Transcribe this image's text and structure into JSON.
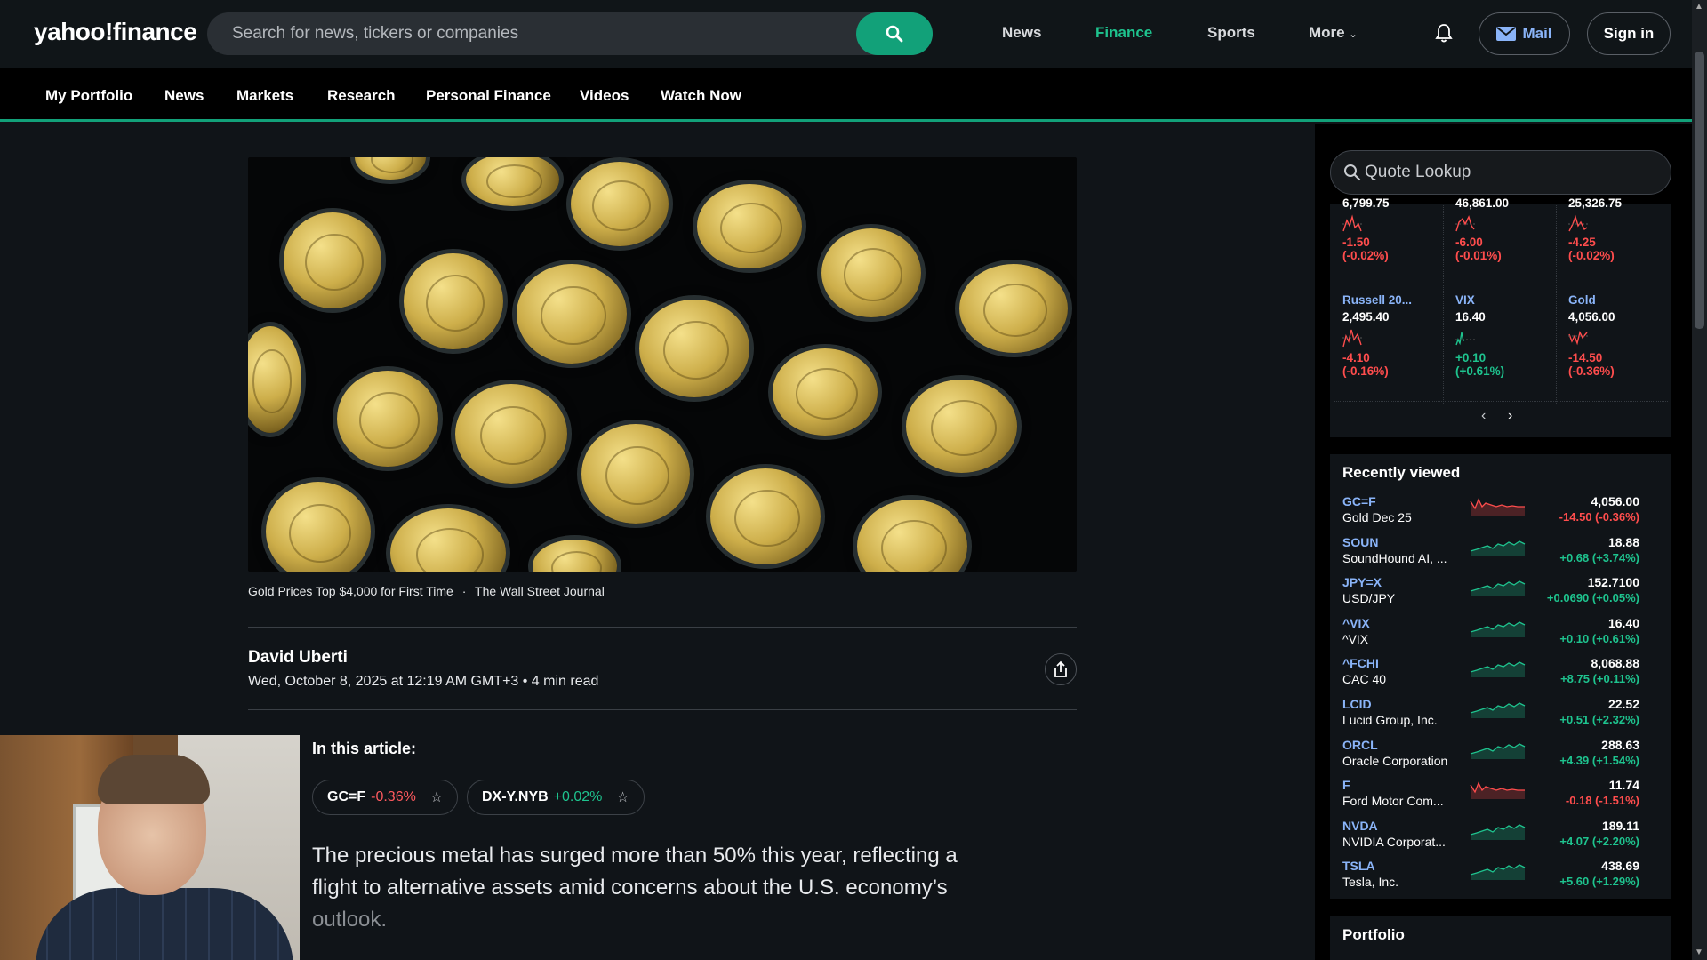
{
  "header": {
    "logo": "yahoo!finance",
    "search_placeholder": "Search for news, tickers or companies",
    "nav": [
      "News",
      "Finance",
      "Sports",
      "More"
    ],
    "active_nav": "Finance",
    "mail_label": "Mail",
    "signin_label": "Sign in"
  },
  "subnav": [
    "My Portfolio",
    "News",
    "Markets",
    "Research",
    "Personal Finance",
    "Videos",
    "Watch Now"
  ],
  "article": {
    "caption": "Gold Prices Top $4,000 for First Time",
    "caption_sep": "·",
    "source": "The Wall Street Journal",
    "author": "David Uberti",
    "dateline": "Wed, October 8, 2025 at 12:19 AM GMT+3 • 4 min read",
    "in_article_label": "In this article:",
    "tickers": [
      {
        "symbol": "GC=F",
        "change": "-0.36%",
        "direction": "down"
      },
      {
        "symbol": "DX-Y.NYB",
        "change": "+0.02%",
        "direction": "up"
      }
    ],
    "lede_main": "The precious metal has surged more than 50% this year, reflecting a flight to alternative assets amid concerns about the U.S. economy’s",
    "lede_faded": "outlook."
  },
  "right_rail": {
    "quote_placeholder": "Quote Lookup",
    "markets_top": [
      {
        "value": "6,799.75",
        "change": "-1.50",
        "pct": "(-0.02%)",
        "direction": "down"
      },
      {
        "value": "46,861.00",
        "change": "-6.00",
        "pct": "(-0.01%)",
        "direction": "down"
      },
      {
        "value": "25,326.75",
        "change": "-4.25",
        "pct": "(-0.02%)",
        "direction": "down"
      }
    ],
    "markets_bottom": [
      {
        "name": "Russell 20...",
        "value": "2,495.40",
        "change": "-4.10",
        "pct": "(-0.16%)",
        "direction": "down"
      },
      {
        "name": "VIX",
        "value": "16.40",
        "change": "+0.10",
        "pct": "(+0.61%)",
        "direction": "up"
      },
      {
        "name": "Gold",
        "value": "4,056.00",
        "change": "-14.50",
        "pct": "(-0.36%)",
        "direction": "down"
      }
    ],
    "recently_viewed_title": "Recently viewed",
    "recently_viewed": [
      {
        "symbol": "GC=F",
        "name": "Gold Dec 25",
        "price": "4,056.00",
        "change": "-14.50 (-0.36%)",
        "direction": "down"
      },
      {
        "symbol": "SOUN",
        "name": "SoundHound AI, ...",
        "price": "18.88",
        "change": "+0.68 (+3.74%)",
        "direction": "up"
      },
      {
        "symbol": "JPY=X",
        "name": "USD/JPY",
        "price": "152.7100",
        "change": "+0.0690 (+0.05%)",
        "direction": "up"
      },
      {
        "symbol": "^VIX",
        "name": "^VIX",
        "price": "16.40",
        "change": "+0.10 (+0.61%)",
        "direction": "up"
      },
      {
        "symbol": "^FCHI",
        "name": "CAC 40",
        "price": "8,068.88",
        "change": "+8.75 (+0.11%)",
        "direction": "up"
      },
      {
        "symbol": "LCID",
        "name": "Lucid Group, Inc.",
        "price": "22.52",
        "change": "+0.51 (+2.32%)",
        "direction": "up"
      },
      {
        "symbol": "ORCL",
        "name": "Oracle Corporation",
        "price": "288.63",
        "change": "+4.39 (+1.54%)",
        "direction": "up"
      },
      {
        "symbol": "F",
        "name": "Ford Motor Com...",
        "price": "11.74",
        "change": "-0.18 (-1.51%)",
        "direction": "down"
      },
      {
        "symbol": "NVDA",
        "name": "NVIDIA Corporat...",
        "price": "189.11",
        "change": "+4.07 (+2.20%)",
        "direction": "up"
      },
      {
        "symbol": "TSLA",
        "name": "Tesla, Inc.",
        "price": "438.69",
        "change": "+5.60 (+1.29%)",
        "direction": "up"
      }
    ],
    "portfolio_title": "Portfolio"
  },
  "colors": {
    "accent": "#12a179",
    "link": "#8ab4f8",
    "negative": "#ff4d4d",
    "positive": "#1ec38e"
  }
}
